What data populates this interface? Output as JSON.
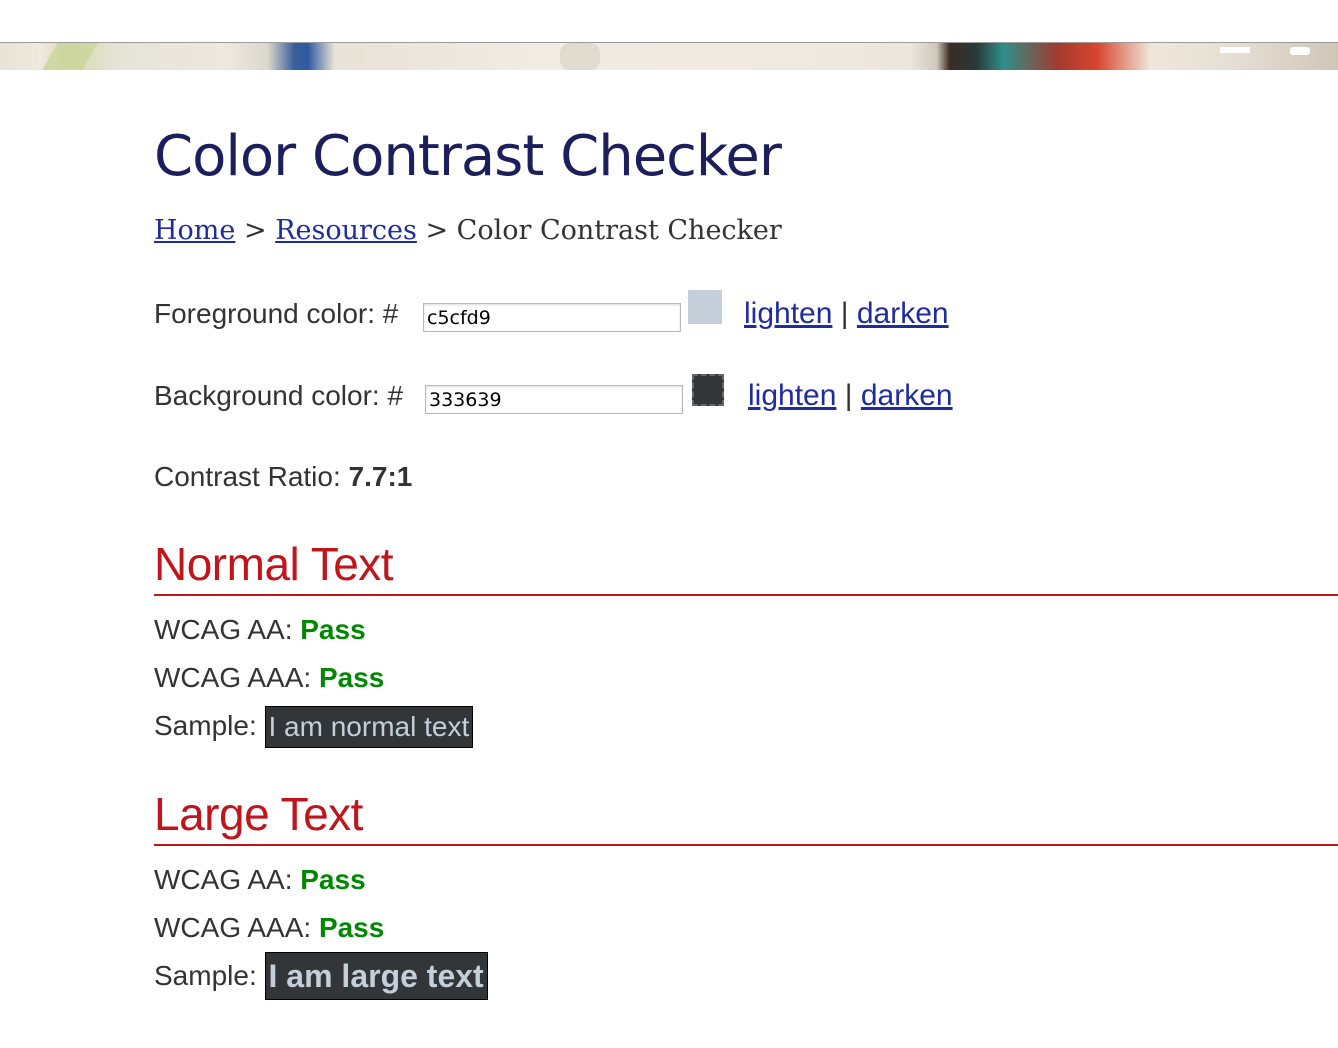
{
  "page": {
    "title": "Color Contrast Checker"
  },
  "breadcrumb": {
    "home": "Home",
    "sep1": " > ",
    "resources": "Resources",
    "sep2": " > ",
    "current": "Color Contrast Checker"
  },
  "foreground": {
    "label": "Foreground color: #",
    "value": "c5cfd9",
    "lighten": "lighten",
    "separator": " | ",
    "darken": "darken",
    "swatch_color": "#c5cfd9"
  },
  "background": {
    "label": "Background color: #",
    "value": "333639",
    "lighten": "lighten",
    "separator": " | ",
    "darken": "darken",
    "swatch_color": "#333639"
  },
  "contrast": {
    "label": "Contrast Ratio: ",
    "value": "7.7:1"
  },
  "normal_text": {
    "heading": "Normal Text",
    "aa_label": "WCAG AA: ",
    "aa_result": "Pass",
    "aaa_label": "WCAG AAA: ",
    "aaa_result": "Pass",
    "sample_label": "Sample: ",
    "sample_text": "I am normal text"
  },
  "large_text": {
    "heading": "Large Text",
    "aa_label": "WCAG AA: ",
    "aa_result": "Pass",
    "aaa_label": "WCAG AAA: ",
    "aaa_result": "Pass",
    "sample_label": "Sample: ",
    "sample_text": "I am large text"
  },
  "colors": {
    "title": "#1c1f5c",
    "link": "#1f2d9c",
    "section_heading": "#c0161b",
    "pass": "#008800"
  }
}
